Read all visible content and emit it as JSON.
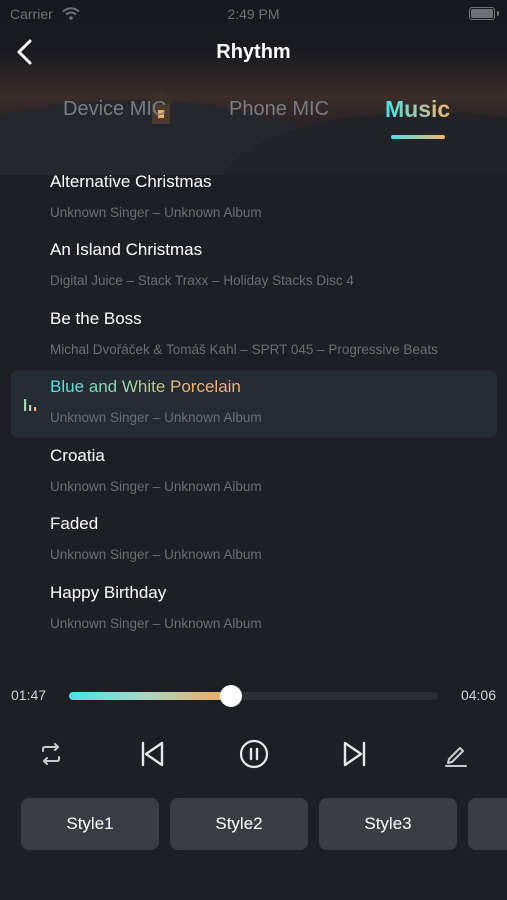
{
  "status_bar": {
    "carrier": "Carrier",
    "time": "2:49 PM"
  },
  "header": {
    "title": "Rhythm"
  },
  "tabs": [
    {
      "label": "Device MIC",
      "active": false
    },
    {
      "label": "Phone MIC",
      "active": false
    },
    {
      "label": "Music",
      "active": true
    }
  ],
  "songs": [
    {
      "title": "Alternative Christmas",
      "meta": "Unknown Singer – Unknown Album",
      "playing": false
    },
    {
      "title": "An Island Christmas",
      "meta": "Digital Juice – Stack Traxx – Holiday Stacks Disc 4",
      "playing": false
    },
    {
      "title": "Be the Boss",
      "meta": "Michal Dvořáček & Tomáš Kahl – SPRT 045 – Progressive Beats",
      "playing": false
    },
    {
      "title": "Blue and White Porcelain",
      "meta": "Unknown Singer – Unknown Album",
      "playing": true
    },
    {
      "title": "Croatia",
      "meta": "Unknown Singer – Unknown Album",
      "playing": false
    },
    {
      "title": "Faded",
      "meta": "Unknown Singer – Unknown Album",
      "playing": false
    },
    {
      "title": "Happy Birthday",
      "meta": "Unknown Singer – Unknown Album",
      "playing": false
    }
  ],
  "player": {
    "current_time": "01:47",
    "duration": "04:06",
    "progress": 0.44
  },
  "styles": [
    {
      "label": "Style1"
    },
    {
      "label": "Style2"
    },
    {
      "label": "Style3"
    },
    {
      "label": ""
    }
  ],
  "colors": {
    "accent_start": "#47e3e6",
    "accent_end": "#f6b36a",
    "background": "#1d1f25",
    "button": "#3a3d44"
  }
}
